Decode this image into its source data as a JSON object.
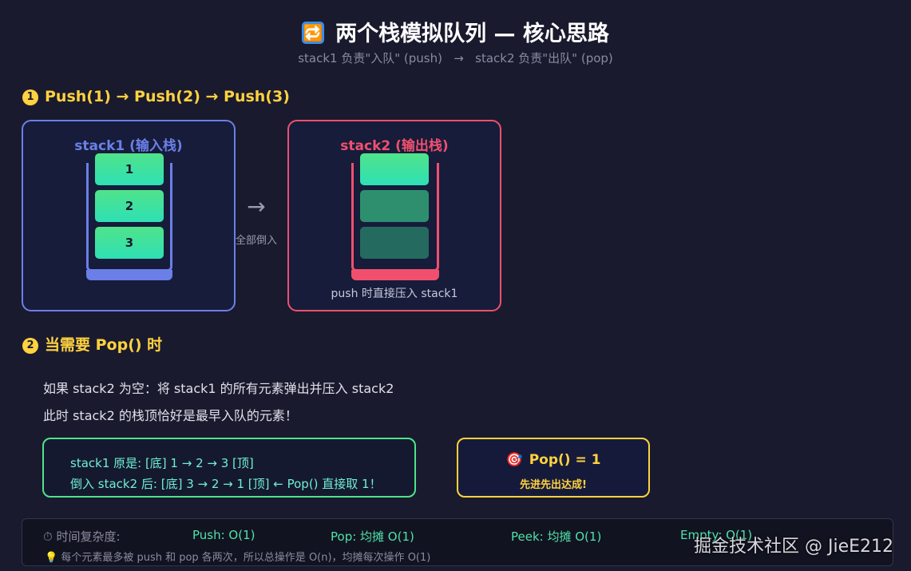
{
  "header": {
    "icon": "🔁",
    "title": "两个栈模拟队列 — 核心思路",
    "subtitle": "stack1 负责\"入队\" (push)   →   stack2 负责\"出队\" (pop)"
  },
  "step1": {
    "num": "1",
    "title": "Push(1) → Push(2) → Push(3)"
  },
  "stack1": {
    "title": "stack1 (输入栈)",
    "items": [
      "1",
      "2",
      "3"
    ],
    "color": "#6b7fe8"
  },
  "transfer": {
    "arrow": "→",
    "label": "全部倒入"
  },
  "stack2": {
    "title": "stack2 (输出栈)",
    "caption": "push 时直接压入 stack1",
    "color": "#f0506e"
  },
  "step2": {
    "num": "2",
    "title": "当需要 Pop() 时",
    "line1": "如果 stack2 为空：将 stack1 的所有元素弹出并压入 stack2",
    "line2": "此时 stack2 的栈顶恰好是最早入队的元素！"
  },
  "info": {
    "line1": "stack1 原是: [底] 1 → 2 → 3 [顶]",
    "line2": "倒入 stack2 后: [底] 3 → 2 → 1 [顶] ← Pop() 直接取 1！"
  },
  "pop": {
    "icon": "🎯",
    "title": "Pop() = 1",
    "subtitle": "先进先出达成!"
  },
  "footer": {
    "label": "⏱ 时间复杂度:",
    "push": "Push: O(1)",
    "pop": "Pop: 均摊 O(1)",
    "peek": "Peek: 均摊 O(1)",
    "empty": "Empty: O(1)",
    "note": "💡 每个元素最多被 push 和 pop 各两次，所以总操作是 O(n)，均摊每次操作 O(1)"
  },
  "watermark": "掘金技术社区 @ JieE212"
}
